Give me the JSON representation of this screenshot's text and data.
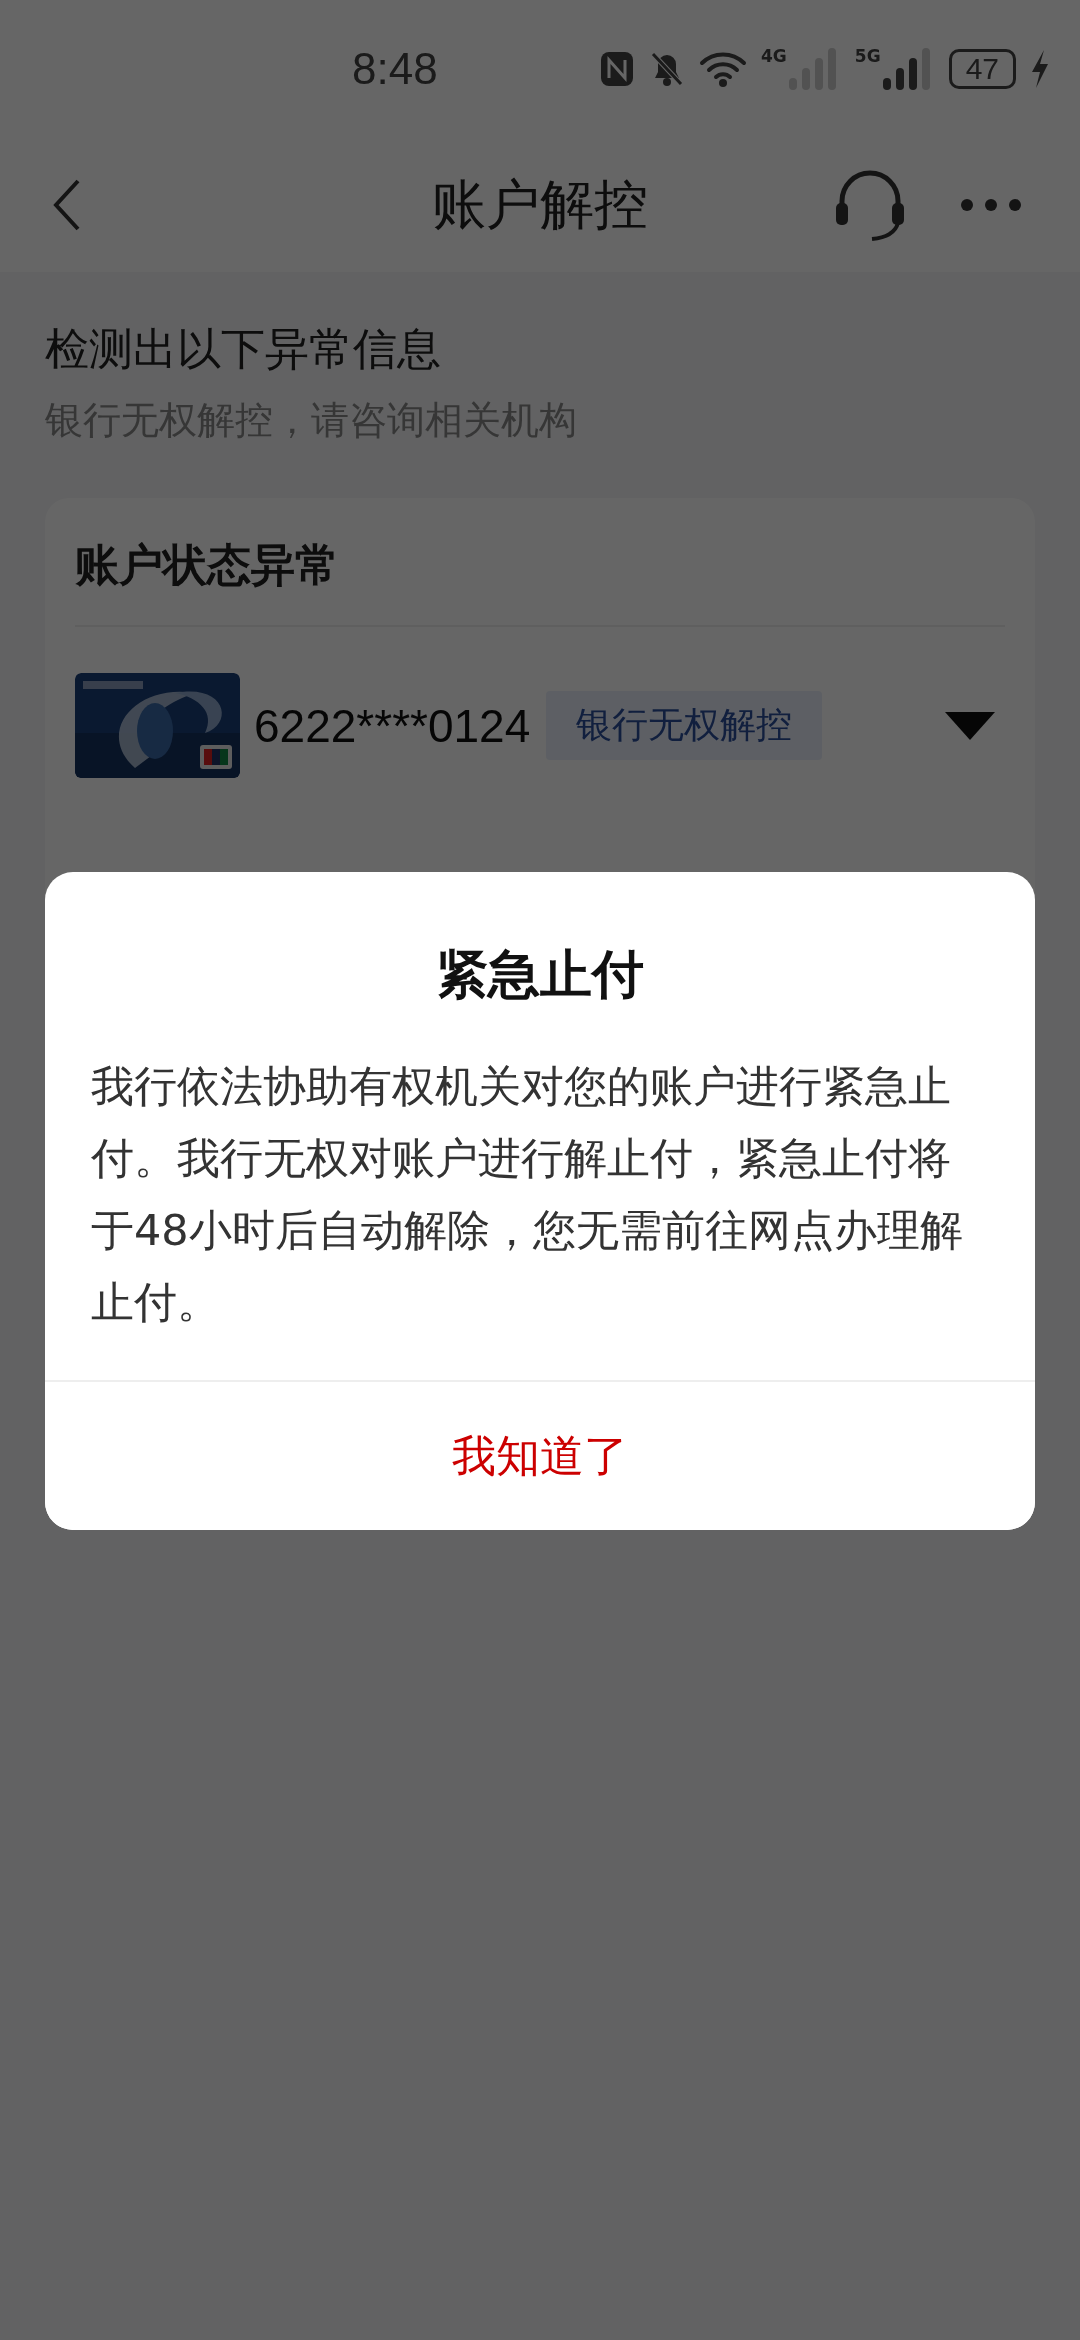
{
  "status_bar": {
    "time": "8:48",
    "network_labels": [
      "4G",
      "5G"
    ],
    "battery": "47"
  },
  "nav": {
    "title": "账户解控"
  },
  "notice": {
    "heading": "检测出以下异常信息",
    "subtext": "银行无权解控，请咨询相关机构"
  },
  "account_card": {
    "title": "账户状态异常",
    "accounts": [
      {
        "number": "6222****0124",
        "tag": "银行无权解控",
        "expanded": false
      }
    ]
  },
  "dialog": {
    "title": "紧急止付",
    "message": "我行依法协助有权机关对您的账户进行紧急止付。我行无权对账户进行解止付，紧急止付将于48小时后自动解除，您无需前往网点办理解止付。",
    "button": "我知道了"
  }
}
